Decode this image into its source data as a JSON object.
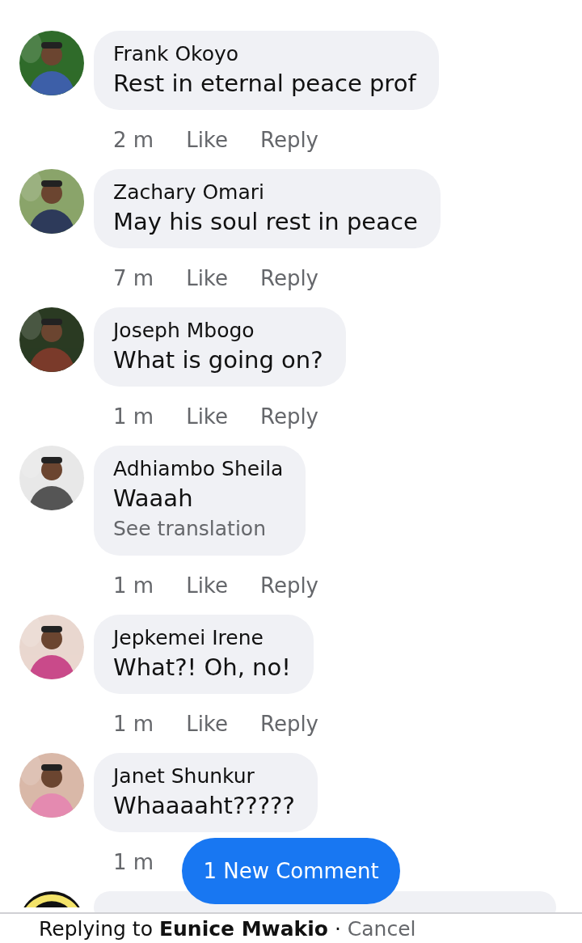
{
  "comments": [
    {
      "author": "Frank Okoyo",
      "text": "Rest in eternal peace prof",
      "time": "2 m",
      "like": "Like",
      "reply": "Reply"
    },
    {
      "author": "Zachary Omari",
      "text": "May his soul rest in peace",
      "time": "7 m",
      "like": "Like",
      "reply": "Reply"
    },
    {
      "author": "Joseph Mbogo",
      "text": "What is going on?",
      "time": "1 m",
      "like": "Like",
      "reply": "Reply"
    },
    {
      "author": "Adhiambo Sheila",
      "text": "Waaah",
      "translation": "See translation",
      "time": "1 m",
      "like": "Like",
      "reply": "Reply"
    },
    {
      "author": "Jepkemei Irene",
      "text": "What?! Oh, no!",
      "time": "1 m",
      "like": "Like",
      "reply": "Reply"
    },
    {
      "author": "Janet Shunkur",
      "text": "Whaaaaht?????",
      "time": "1 m"
    }
  ],
  "more_below": true,
  "new_comment_button": "1 New Comment",
  "reply_bar": {
    "prefix": "Replying to",
    "name": "Eunice Mwakio",
    "separator": "·",
    "cancel": "Cancel"
  }
}
